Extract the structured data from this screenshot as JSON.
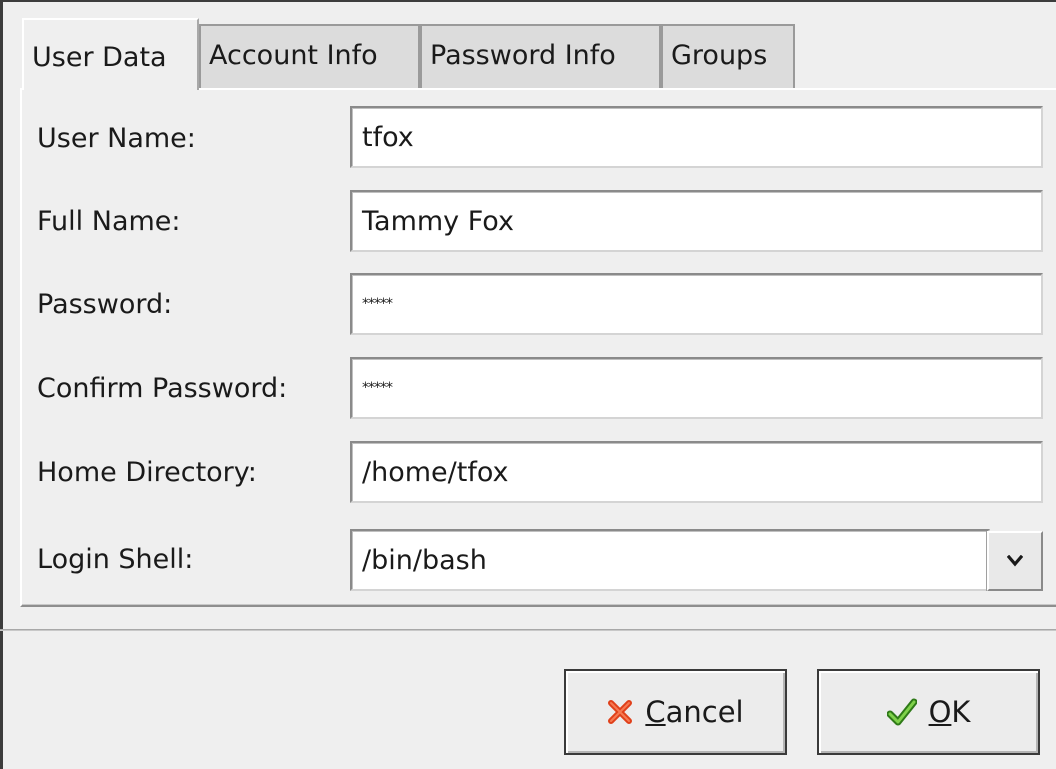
{
  "tabs": [
    {
      "label": "User Data",
      "active": true
    },
    {
      "label": "Account Info",
      "active": false
    },
    {
      "label": "Password Info",
      "active": false
    },
    {
      "label": "Groups",
      "active": false
    }
  ],
  "form": {
    "user_name": {
      "label": "User Name:",
      "value": "tfox"
    },
    "full_name": {
      "label": "Full Name:",
      "value": "Tammy Fox"
    },
    "password": {
      "label": "Password:",
      "value": "*****"
    },
    "confirm_password": {
      "label": "Confirm Password:",
      "value": "*****"
    },
    "home_directory": {
      "label": "Home Directory:",
      "value": "/home/tfox"
    },
    "login_shell": {
      "label": "Login Shell:",
      "value": "/bin/bash"
    }
  },
  "buttons": {
    "cancel": {
      "mnemonic": "C",
      "rest": "ancel",
      "icon": "x-icon"
    },
    "ok": {
      "mnemonic": "O",
      "rest": "K",
      "icon": "checkmark-icon"
    }
  },
  "colors": {
    "cancel_icon": "#e0401a",
    "ok_icon": "#4caf2a"
  }
}
